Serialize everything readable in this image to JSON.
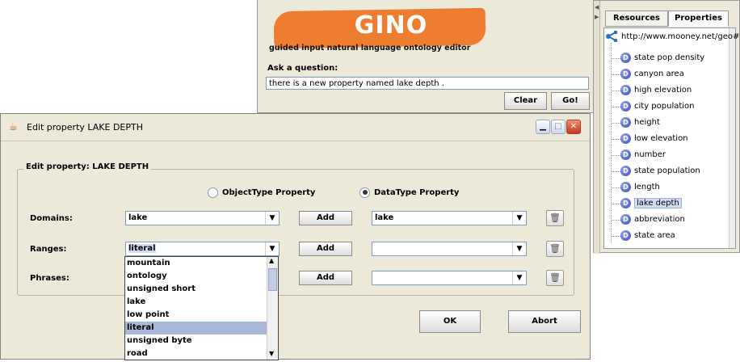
{
  "gino": {
    "title": "GINO",
    "subtitle": "guided input natural language ontology editor",
    "ask_label": "Ask a question:",
    "question_value": "there is a new property named lake depth .",
    "clear_label": "Clear",
    "go_label": "Go!",
    "banner_color": "#ef7d2f"
  },
  "right_panel": {
    "tabs": [
      {
        "label": "Resources",
        "active": false
      },
      {
        "label": "Properties",
        "active": true
      }
    ],
    "root": "http://www.mooney.net/geo#",
    "icon_letter": "D",
    "items": [
      "state pop density",
      "canyon area",
      "high elevation",
      "city population",
      "height",
      "low elevation",
      "number",
      "state population",
      "length",
      "lake depth",
      "abbreviation",
      "state area"
    ],
    "selected_item": "lake depth"
  },
  "dialog": {
    "title": "Edit property LAKE DEPTH",
    "group_title": "Edit property: LAKE DEPTH",
    "radio_object": "ObjectType Property",
    "radio_data": "DataType Property",
    "selected_radio": "DataType Property",
    "rows": {
      "domains": {
        "label": "Domains:",
        "input": "lake",
        "add": "Add",
        "value": "lake"
      },
      "ranges": {
        "label": "Ranges:",
        "input": "literal",
        "add": "Add",
        "value": ""
      },
      "phrases": {
        "label": "Phrases:",
        "input": "",
        "add": "Add",
        "value": ""
      }
    },
    "ok_label": "OK",
    "abort_label": "Abort",
    "dropdown_options": [
      "mountain",
      "ontology",
      "unsigned short",
      "lake",
      "low point",
      "literal",
      "unsigned byte",
      "road"
    ],
    "dropdown_selected": "literal"
  }
}
